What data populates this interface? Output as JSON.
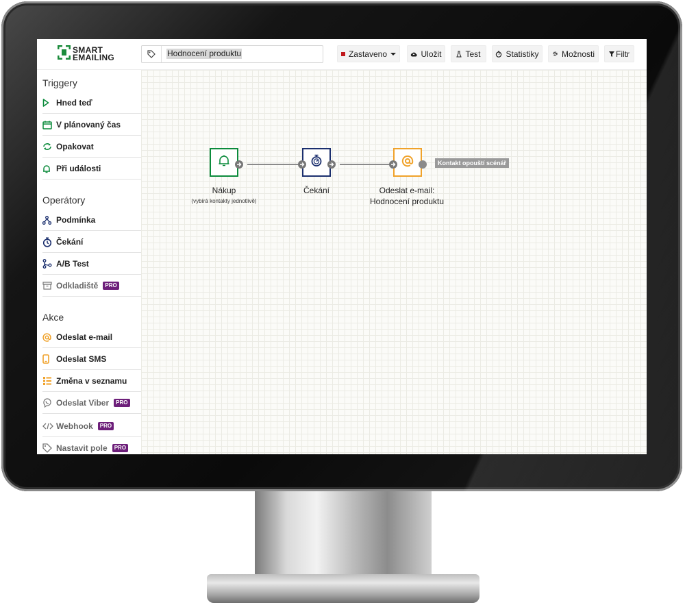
{
  "logo": {
    "line1": "SMART",
    "line2": "EMAILING",
    "icon": "smartemailing-logo-icon"
  },
  "scenario": {
    "name": "Hodnocení produktu",
    "icon": "tag-icon"
  },
  "toolbar": {
    "status": "Zastaveno",
    "save": "Uložit",
    "test": "Test",
    "stats": "Statistiky",
    "options": "Možnosti",
    "filter": "Filtr"
  },
  "sidebar": {
    "triggers_title": "Triggery",
    "triggers": [
      {
        "label": "Hned teď",
        "icon": "play-icon"
      },
      {
        "label": "V plánovaný čas",
        "icon": "calendar-icon"
      },
      {
        "label": "Opakovat",
        "icon": "repeat-icon"
      },
      {
        "label": "Při události",
        "icon": "bell-icon"
      }
    ],
    "operators_title": "Operátory",
    "operators": [
      {
        "label": "Podmínka",
        "icon": "branch-icon"
      },
      {
        "label": "Čekání",
        "icon": "stopwatch-icon"
      },
      {
        "label": "A/B Test",
        "icon": "ab-split-icon"
      },
      {
        "label": "Odkladiště",
        "icon": "archive-box-icon",
        "badge": "PRO"
      }
    ],
    "actions_title": "Akce",
    "actions": [
      {
        "label": "Odeslat e-mail",
        "icon": "at-icon"
      },
      {
        "label": "Odeslat SMS",
        "icon": "phone-icon"
      },
      {
        "label": "Změna v seznamu",
        "icon": "list-icon"
      },
      {
        "label": "Odeslat Viber",
        "icon": "viber-icon",
        "badge": "PRO"
      },
      {
        "label": "Webhook",
        "icon": "code-icon",
        "badge": "PRO"
      },
      {
        "label": "Nastavit pole",
        "icon": "tag-icon",
        "badge": "PRO"
      }
    ]
  },
  "flow": {
    "nodes": [
      {
        "label": "Nákup",
        "sublabel": "(vybírá kontakty jednotlivě)",
        "icon": "bell-icon",
        "color": "#0c8b3c"
      },
      {
        "label": "Čekání",
        "icon": "stopwatch-icon",
        "color": "#1b2f6e"
      },
      {
        "label_line1": "Odeslat e-mail:",
        "label_line2": "Hodnocení produktu",
        "icon": "at-icon",
        "color": "#f0a22a"
      }
    ],
    "exit_label": "Kontakt opouští scénář"
  },
  "colors": {
    "accent_green": "#0c8b3c",
    "wait_navy": "#1b2f6e",
    "email_orange": "#f0a22a",
    "pro_purple": "#6d1f7a",
    "stop_red": "#c0181c"
  }
}
